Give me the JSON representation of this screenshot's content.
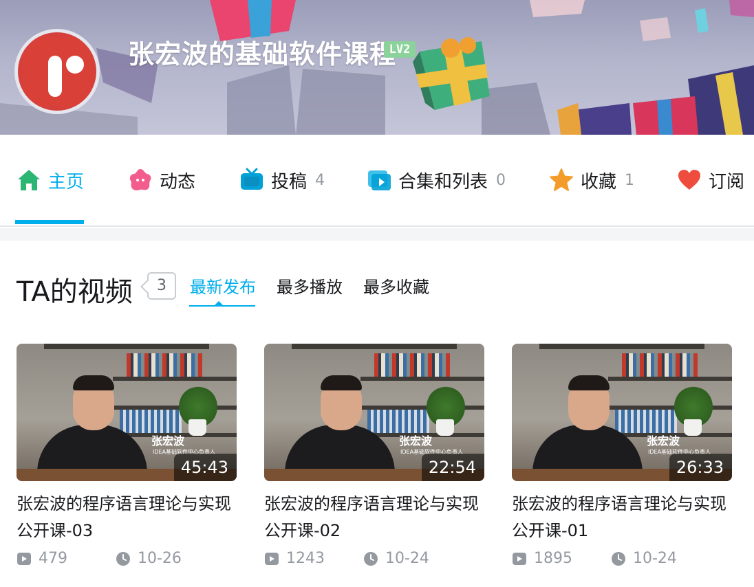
{
  "header": {
    "username": "张宏波的基础软件课程",
    "level": "LV2",
    "accent_color": "#00aeec",
    "level_color": "#8bd29b"
  },
  "nav": {
    "items": [
      {
        "label": "主页",
        "count": "",
        "icon": "home-icon",
        "active": true
      },
      {
        "label": "动态",
        "count": "",
        "icon": "dynamic-icon",
        "active": false
      },
      {
        "label": "投稿",
        "count": "4",
        "icon": "tv-icon",
        "active": false
      },
      {
        "label": "合集和列表",
        "count": "0",
        "icon": "collection-icon",
        "active": false
      },
      {
        "label": "收藏",
        "count": "1",
        "icon": "star-icon",
        "active": false
      },
      {
        "label": "订阅",
        "count": "",
        "icon": "heart-icon",
        "active": false
      }
    ]
  },
  "videos_section": {
    "title": "TA的视频",
    "count": "3",
    "sort_tabs": [
      {
        "label": "最新发布",
        "active": true
      },
      {
        "label": "最多播放",
        "active": false
      },
      {
        "label": "最多收藏",
        "active": false
      }
    ]
  },
  "videos": [
    {
      "title": "张宏波的程序语言理论与实现公开课-03",
      "duration": "45:43",
      "plays": "479",
      "date": "10-26",
      "caption_name": "张宏波",
      "caption_sub": "IDEA基础软件中心负责人"
    },
    {
      "title": "张宏波的程序语言理论与实现公开课-02",
      "duration": "22:54",
      "plays": "1243",
      "date": "10-24",
      "caption_name": "张宏波",
      "caption_sub": "IDEA基础软件中心负责人"
    },
    {
      "title": "张宏波的程序语言理论与实现公开课-01",
      "duration": "26:33",
      "plays": "1895",
      "date": "10-24",
      "caption_name": "张宏波",
      "caption_sub": "IDEA基础软件中心负责人"
    }
  ]
}
